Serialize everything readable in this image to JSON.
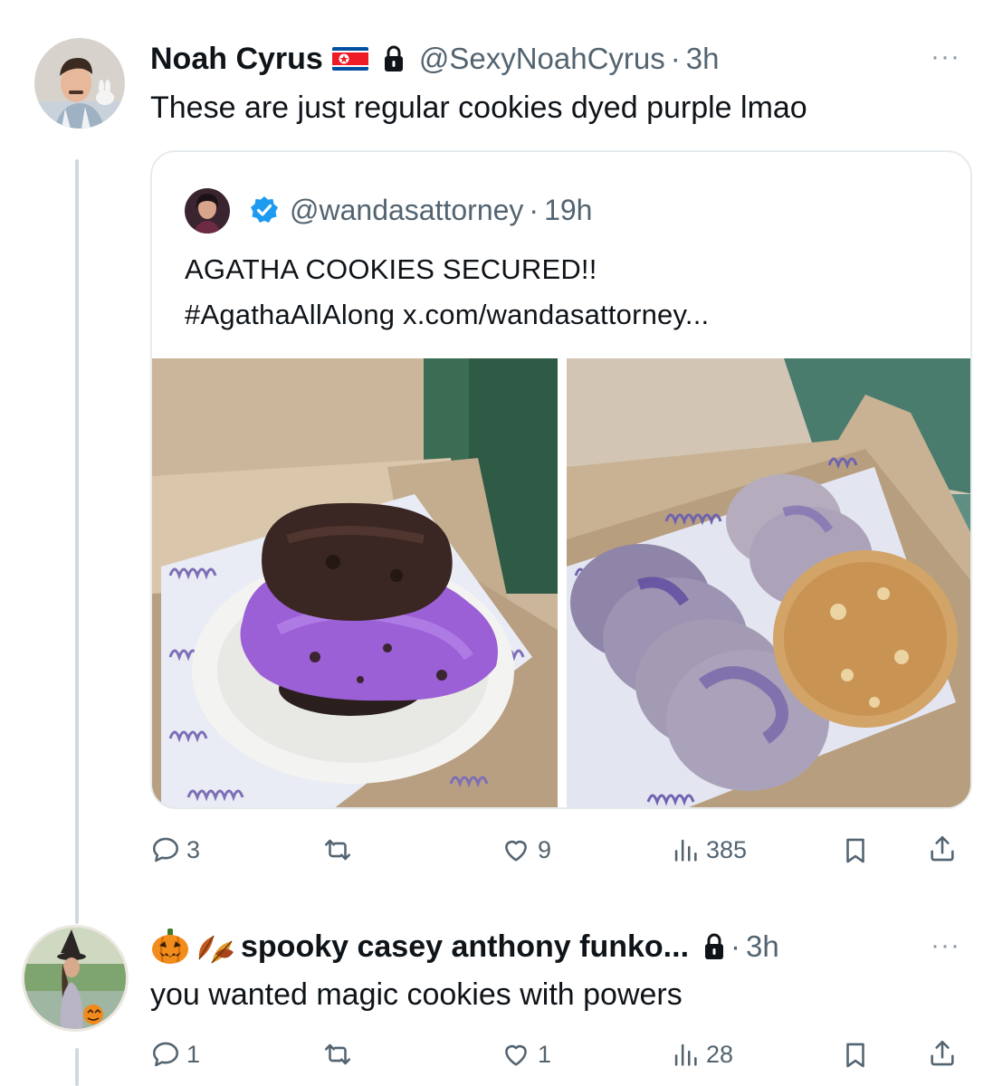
{
  "tweet": {
    "display_name": "Noah Cyrus",
    "handle": "@SexyNoahCyrus",
    "separator": "·",
    "time": "3h",
    "more_label": "···",
    "text": "These are just regular cookies dyed purple lmao",
    "flag_icon": "north-korea-flag-icon",
    "lock_icon": "lock-icon"
  },
  "quoted": {
    "handle": "@wandasattorney",
    "separator": "·",
    "time": "19h",
    "verified_icon": "verified-badge-icon",
    "text_line1": "AGATHA COOKIES SECURED!!",
    "text_line2": "#AgathaAllAlong x.com/wandasattorney...",
    "images": [
      "purple-ice-cream-cookie-sandwich",
      "purple-swirl-cookies-in-box"
    ]
  },
  "tweet_actions": {
    "replies": "3",
    "retweets": "",
    "likes": "9",
    "views": "385"
  },
  "reply": {
    "emoji_icons": [
      "jack-o-lantern-icon",
      "autumn-leaves-icon"
    ],
    "display_name": "spooky casey anthony funko...",
    "separator": "·",
    "time": "3h",
    "more_label": "···",
    "text": "you wanted magic cookies with powers",
    "lock_icon": "lock-icon"
  },
  "reply_actions": {
    "replies": "1",
    "retweets": "",
    "likes": "1",
    "views": "28"
  },
  "colors": {
    "text": "#0f1419",
    "muted": "#536471",
    "verified": "#1d9bf0",
    "thread_line": "#cfd9de"
  }
}
